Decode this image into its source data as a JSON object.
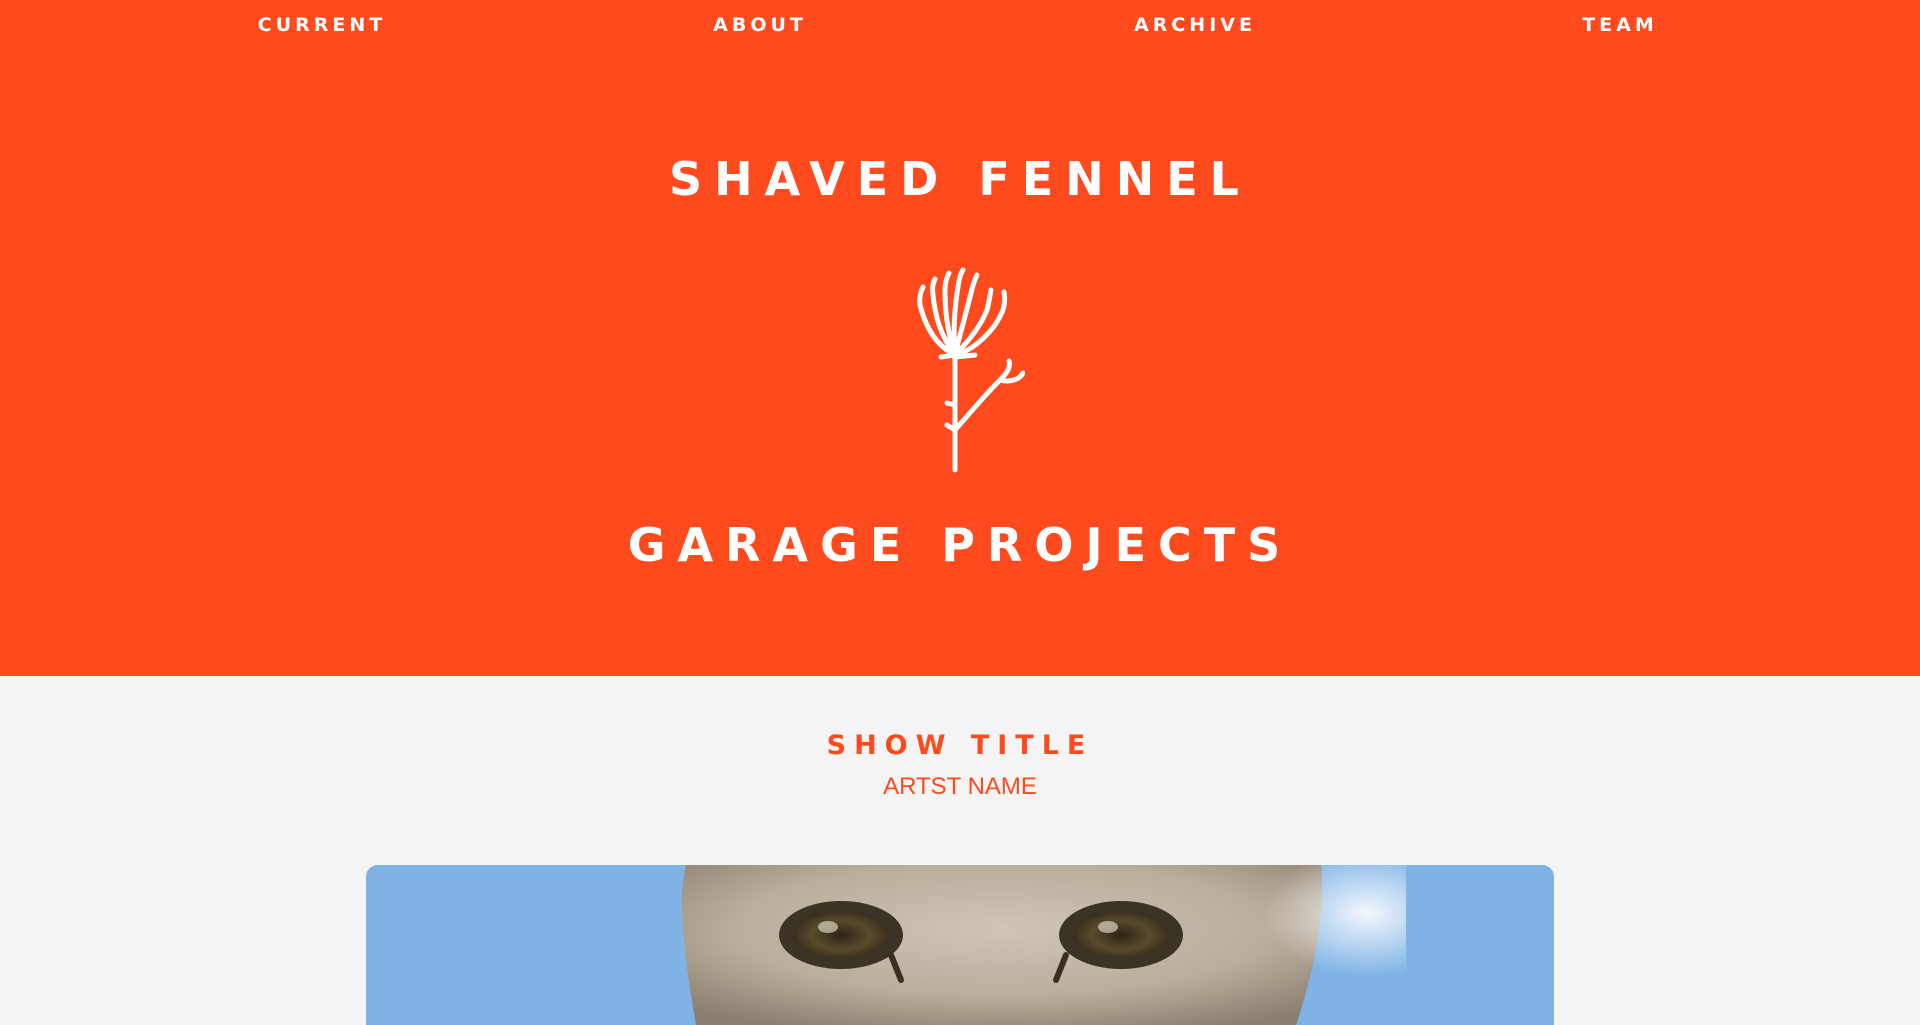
{
  "nav": {
    "items": [
      {
        "label": "CURRENT"
      },
      {
        "label": "ABOUT"
      },
      {
        "label": "ARCHIVE"
      },
      {
        "label": "TEAM"
      }
    ]
  },
  "hero": {
    "title_top": "SHAVED FENNEL",
    "title_bottom": "GARAGE PROJECTS",
    "logo_icon": "fennel-sprig-icon"
  },
  "show": {
    "title": "SHOW TITLE",
    "artist": "ARTST NAME",
    "image_icon": "cat-photo"
  },
  "colors": {
    "accent": "#ff4a1e",
    "background": "#f4f4f4",
    "text_on_accent": "#ffffff"
  }
}
